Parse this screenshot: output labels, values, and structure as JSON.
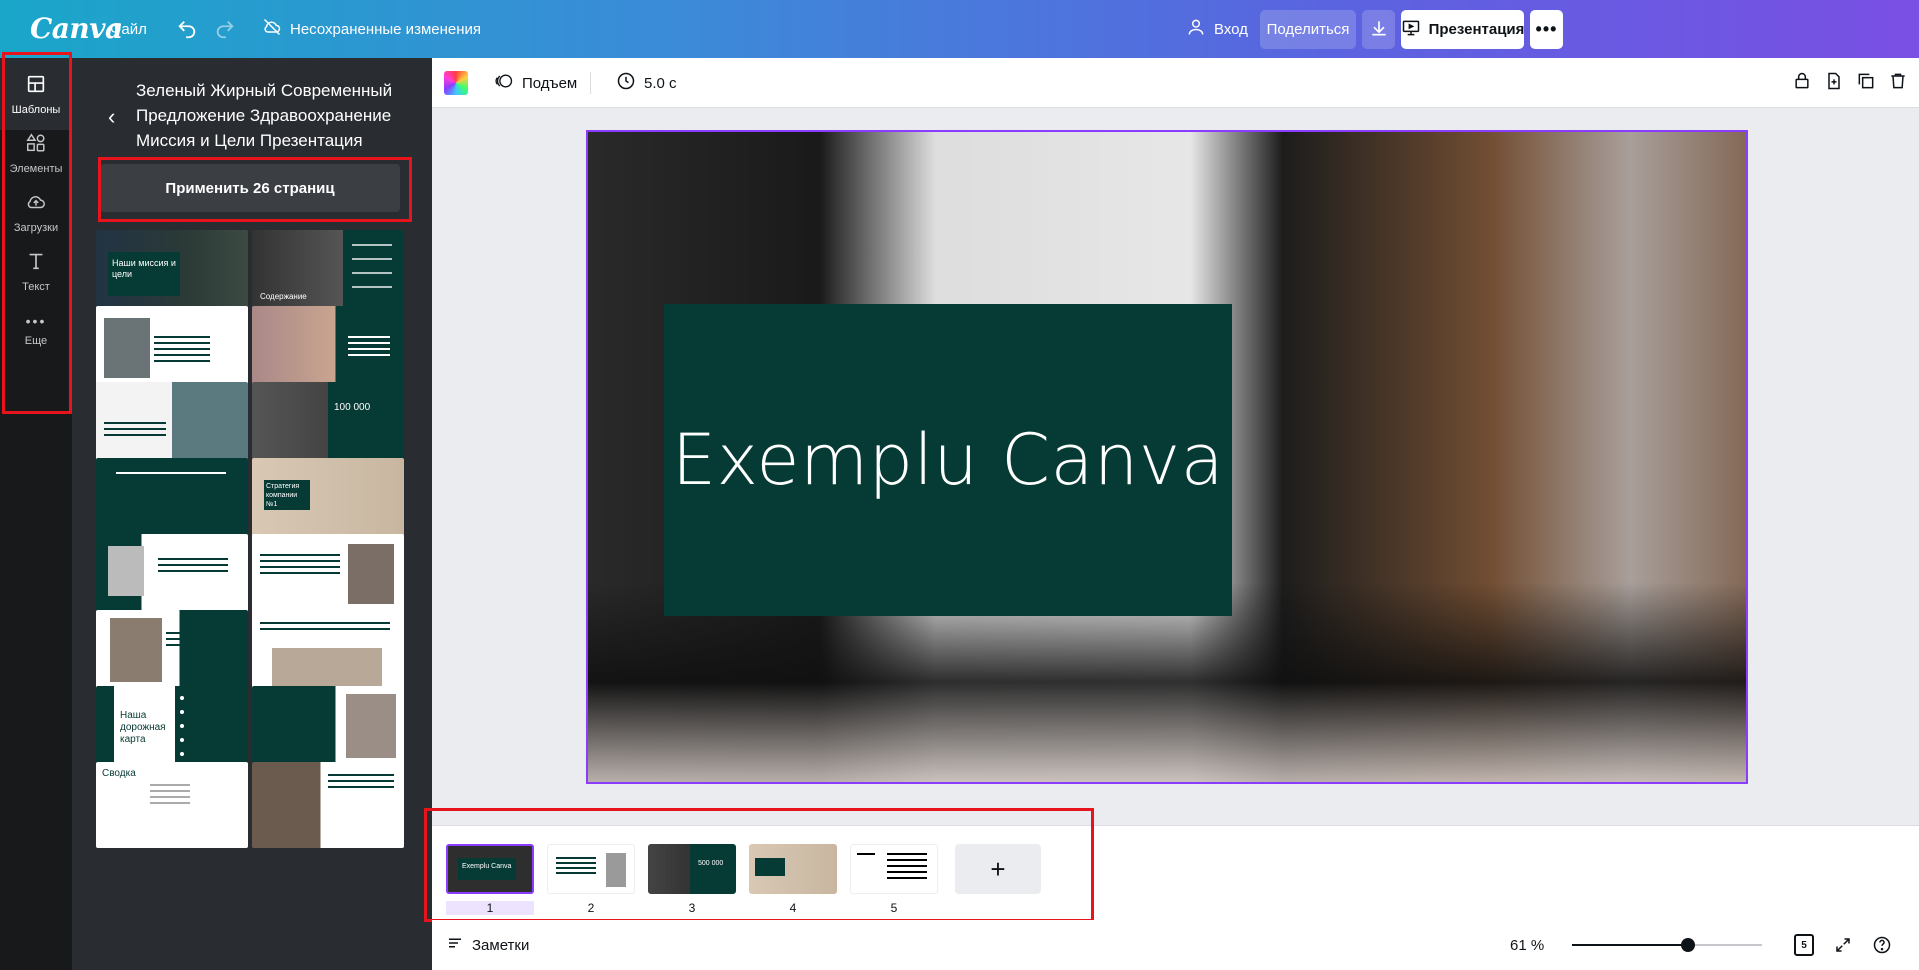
{
  "topbar": {
    "logo": "Canva",
    "file_menu": "Файл",
    "save_status": "Несохраненные изменения",
    "login": "Вход",
    "share": "Поделиться",
    "present": "Презентация"
  },
  "rail": {
    "items": [
      {
        "label": "Шаблоны",
        "icon": "layout-icon"
      },
      {
        "label": "Элементы",
        "icon": "shapes-icon"
      },
      {
        "label": "Загрузки",
        "icon": "cloud-upload-icon"
      },
      {
        "label": "Текст",
        "icon": "text-icon"
      },
      {
        "label": "Еще",
        "icon": "more-dots-icon"
      }
    ]
  },
  "panel": {
    "title": "Зеленый Жирный Современный Предложение Здравоохранение Миссия и Цели Презентация",
    "apply_button": "Применить 26 страниц",
    "thumbnails": [
      {
        "text": "Наши миссия и цели"
      },
      {
        "text": "Содержание"
      },
      {
        "text": ""
      },
      {
        "text": ""
      },
      {
        "text": ""
      },
      {
        "text": "100 000"
      },
      {
        "text": ""
      },
      {
        "text": "Стратегия компании №1"
      },
      {
        "text": ""
      },
      {
        "text": ""
      },
      {
        "text": ""
      },
      {
        "text": ""
      },
      {
        "text": "Наша дорожная карта"
      },
      {
        "text": ""
      },
      {
        "text": "Сводка"
      },
      {
        "text": ""
      }
    ]
  },
  "editbar": {
    "animation": "Подъем",
    "duration": "5.0 с"
  },
  "slide": {
    "title": "Exemplu Canva"
  },
  "pages": {
    "items": [
      {
        "num": "1"
      },
      {
        "num": "2"
      },
      {
        "num": "3"
      },
      {
        "num": "4"
      },
      {
        "num": "5"
      }
    ],
    "add": "+"
  },
  "bottombar": {
    "notes": "Заметки",
    "zoom": "61 %",
    "page_count": "5",
    "zoom_level": 0.61
  },
  "colors": {
    "accent": "#8b3dff",
    "slide_green": "#063a34",
    "highlight_red": "#e8141d"
  }
}
